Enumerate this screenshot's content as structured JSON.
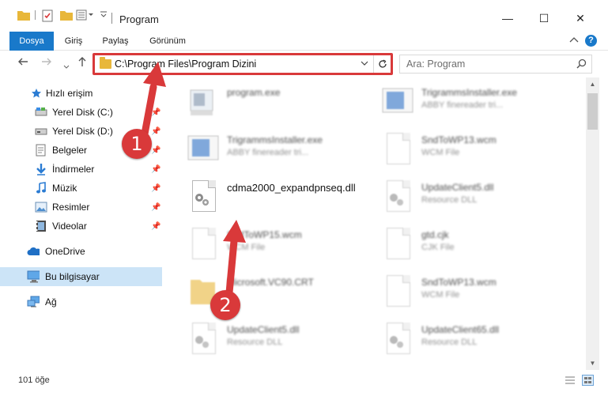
{
  "window": {
    "title": "Program",
    "minimize": "—",
    "maximize": "☐",
    "close": "✕"
  },
  "ribbon": {
    "tabs": [
      "Dosya",
      "Giriş",
      "Paylaş",
      "Görünüm"
    ]
  },
  "address": {
    "path": "C:\\Program Files\\Program Dizini"
  },
  "search": {
    "placeholder": "Ara: Program"
  },
  "sidebar": {
    "items": [
      {
        "label": "Hızlı erişim",
        "icon": "star-icon"
      },
      {
        "label": "Yerel Disk (C:)",
        "icon": "drive-icon"
      },
      {
        "label": "Yerel Disk (D:)",
        "icon": "drive-icon"
      },
      {
        "label": "Belgeler",
        "icon": "documents-icon"
      },
      {
        "label": "İndirmeler",
        "icon": "download-icon"
      },
      {
        "label": "Müzik",
        "icon": "music-icon"
      },
      {
        "label": "Resimler",
        "icon": "pictures-icon"
      },
      {
        "label": "Videolar",
        "icon": "video-icon"
      },
      {
        "label": "OneDrive",
        "icon": "cloud-icon"
      },
      {
        "label": "Bu bilgisayar",
        "icon": "computer-icon"
      },
      {
        "label": "Ağ",
        "icon": "network-icon"
      }
    ]
  },
  "files": [
    {
      "name": "program.exe",
      "type": ""
    },
    {
      "name": "TrigrammsInstaller.exe",
      "type": "ABBY finereader tri..."
    },
    {
      "name": "TrigrammsInstaller.exe",
      "type": "ABBY finereader tri..."
    },
    {
      "name": "SndToWP13.wcm",
      "type": "WCM File"
    },
    {
      "name": "cdma2000_expandpnseq.dll",
      "type": ""
    },
    {
      "name": "UpdateClient5.dll",
      "type": "Resource DLL"
    },
    {
      "name": "SndToWP15.wcm",
      "type": "WCM File"
    },
    {
      "name": "gtd.cjk",
      "type": "CJK File"
    },
    {
      "name": "Microsoft.VC90.CRT",
      "type": ""
    },
    {
      "name": "SndToWP13.wcm",
      "type": "WCM File"
    },
    {
      "name": "UpdateClient5.dll",
      "type": "Resource DLL"
    },
    {
      "name": "UpdateClient65.dll",
      "type": "Resource DLL"
    }
  ],
  "status": {
    "count": "101 öğe"
  },
  "annotations": {
    "step1": "1",
    "step2": "2"
  },
  "colors": {
    "accent": "#1979ca",
    "highlight": "#d9393a",
    "selection": "#cce4f7"
  }
}
